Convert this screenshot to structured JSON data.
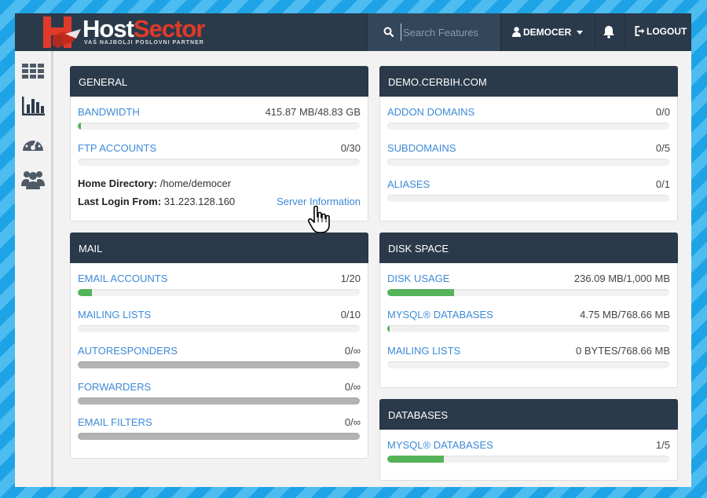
{
  "header": {
    "logo": {
      "brand_host": "Host",
      "brand_sector": "Sector",
      "tagline": "VAŠ NAJBOLJI POSLOVNI PARTNER"
    },
    "search": {
      "placeholder": "Search Features",
      "value": ""
    },
    "user": {
      "name": "DEMOCER"
    },
    "logout_label": "LOGOUT"
  },
  "sidebar": {
    "items": [
      {
        "icon": "grid-icon"
      },
      {
        "icon": "bar-chart-icon"
      },
      {
        "icon": "gauge-icon"
      },
      {
        "icon": "users-icon"
      }
    ]
  },
  "panels": {
    "general": {
      "title": "GENERAL",
      "stats": [
        {
          "label": "BANDWIDTH",
          "value": "415.87 MB/48.83 GB",
          "fill_pct": 0.8
        },
        {
          "label": "FTP ACCOUNTS",
          "value": "0/30",
          "fill_pct": 0
        }
      ],
      "home_dir_label": "Home Directory:",
      "home_dir_value": "/home/democer",
      "last_login_label": "Last Login From:",
      "last_login_value": "31.223.128.160",
      "server_info_link": "Server Information"
    },
    "domain": {
      "title": "DEMO.CERBIH.COM",
      "stats": [
        {
          "label": "ADDON DOMAINS",
          "value": "0/0",
          "fill_pct": 0
        },
        {
          "label": "SUBDOMAINS",
          "value": "0/5",
          "fill_pct": 0
        },
        {
          "label": "ALIASES",
          "value": "0/1",
          "fill_pct": 0
        }
      ]
    },
    "mail": {
      "title": "MAIL",
      "stats": [
        {
          "label": "EMAIL ACCOUNTS",
          "value": "1/20",
          "fill_pct": 5,
          "unlimited": false
        },
        {
          "label": "MAILING LISTS",
          "value": "0/10",
          "fill_pct": 0,
          "unlimited": false
        },
        {
          "label": "AUTORESPONDERS",
          "value": "0/∞",
          "fill_pct": 0,
          "unlimited": true
        },
        {
          "label": "FORWARDERS",
          "value": "0/∞",
          "fill_pct": 0,
          "unlimited": true
        },
        {
          "label": "EMAIL FILTERS",
          "value": "0/∞",
          "fill_pct": 0,
          "unlimited": true
        }
      ]
    },
    "disk": {
      "title": "DISK SPACE",
      "stats": [
        {
          "label": "DISK USAGE",
          "value": "236.09 MB/1,000 MB",
          "fill_pct": 23.6
        },
        {
          "label": "MYSQL® DATABASES",
          "value": "4.75 MB/768.66 MB",
          "fill_pct": 0.6
        },
        {
          "label": "MAILING LISTS",
          "value": "0 BYTES/768.66 MB",
          "fill_pct": 0
        }
      ]
    },
    "databases": {
      "title": "DATABASES",
      "stats": [
        {
          "label": "MYSQL® DATABASES",
          "value": "1/5",
          "fill_pct": 20
        }
      ]
    }
  },
  "colors": {
    "header_bg": "#2b3a4a",
    "link": "#3d8ad8",
    "progress_fill": "#55b35a",
    "unlimited_bar": "#b3b3b3",
    "brand_red": "#e03a2a"
  }
}
